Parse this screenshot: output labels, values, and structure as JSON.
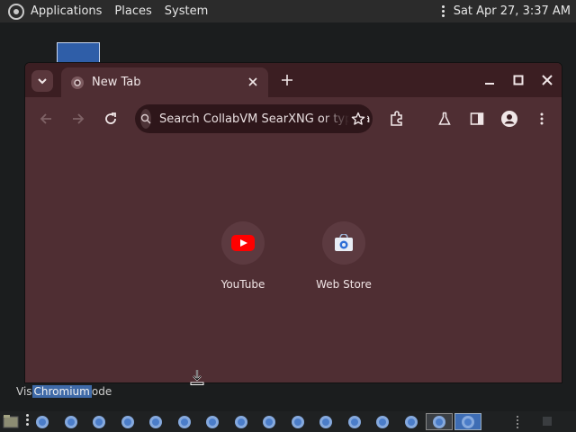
{
  "top_panel": {
    "menu": [
      "Applications",
      "Places",
      "System"
    ],
    "clock": "Sat Apr 27,  3:37 AM"
  },
  "browser": {
    "tab": {
      "title": "New Tab"
    },
    "omnibox": {
      "text": "Search CollabVM SearXNG or type a URL"
    },
    "shortcuts": [
      {
        "label": "YouTube",
        "icon": "youtube-icon"
      },
      {
        "label": "Web Store",
        "icon": "webstore-icon"
      }
    ],
    "colors": {
      "frame": "#3b1e22",
      "content": "#4f2e33",
      "omnibox": "#2e161a"
    }
  },
  "tooltip": {
    "prefix": "Vis",
    "highlight": "Chromium",
    "suffix": "ode"
  },
  "taskbar": {
    "task_count": 16,
    "active_index": 14,
    "selected_index": 15
  }
}
